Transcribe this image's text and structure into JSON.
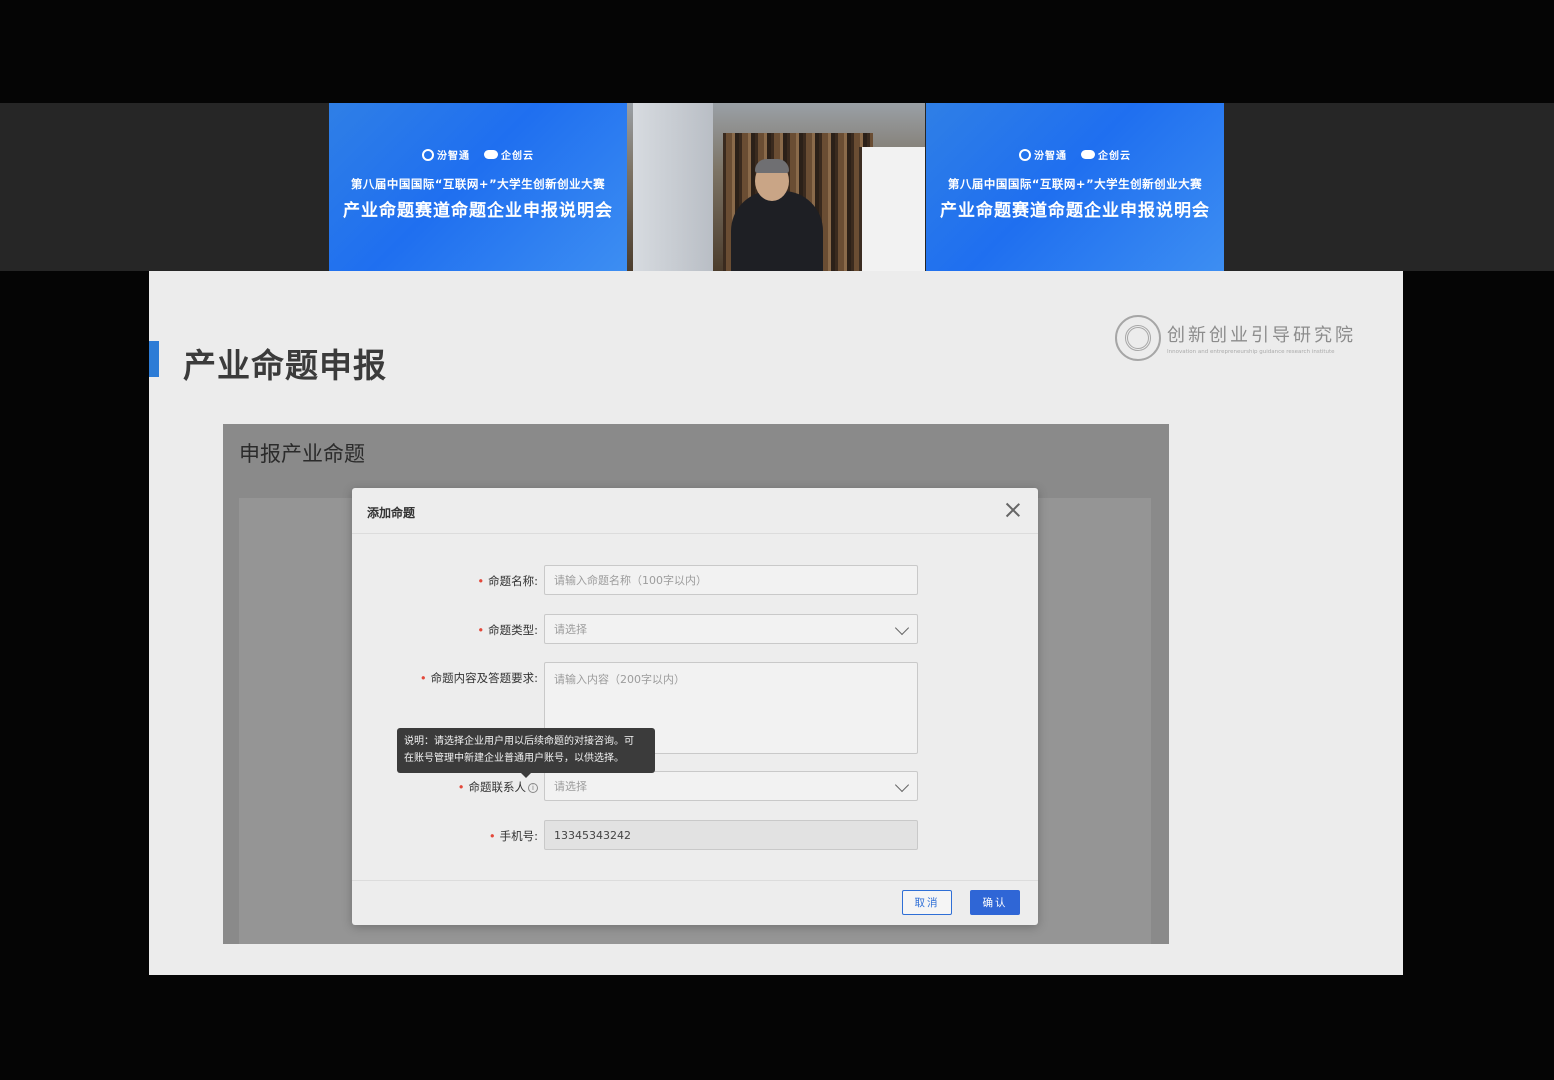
{
  "banner": {
    "logo_left": "汾智通",
    "logo_right": "企创云",
    "line1": "第八届中国国际“互联网+”大学生创新创业大赛",
    "line2": "产业命题赛道命题企业申报说明会"
  },
  "slide": {
    "title": "产业命题申报",
    "institute_cn": "创新创业引导研究院",
    "institute_en": "Innovation and entrepreneurship guidance research institute"
  },
  "page": {
    "title": "申报产业命题"
  },
  "modal": {
    "title": "添加命题",
    "fields": {
      "name": {
        "label": "命题名称:",
        "placeholder": "请输入命题名称（100字以内）"
      },
      "type": {
        "label": "命题类型:",
        "placeholder": "请选择"
      },
      "content": {
        "label": "命题内容及答题要求:",
        "placeholder": "请输入内容（200字以内）"
      },
      "contact": {
        "label": "命题联系人",
        "placeholder": "请选择"
      },
      "phone": {
        "label": "手机号:",
        "value": "13345343242"
      }
    },
    "tooltip_line1": "说明：请选择企业用户用以后续命题的对接咨询。可",
    "tooltip_line2": "在账号管理中新建企业普通用户账号，以供选择。",
    "cancel_label": "取消",
    "ok_label": "确认"
  },
  "colors": {
    "accent": "#2f66d6",
    "required": "#e3483a",
    "banner_blue": "#1f6ff0"
  }
}
